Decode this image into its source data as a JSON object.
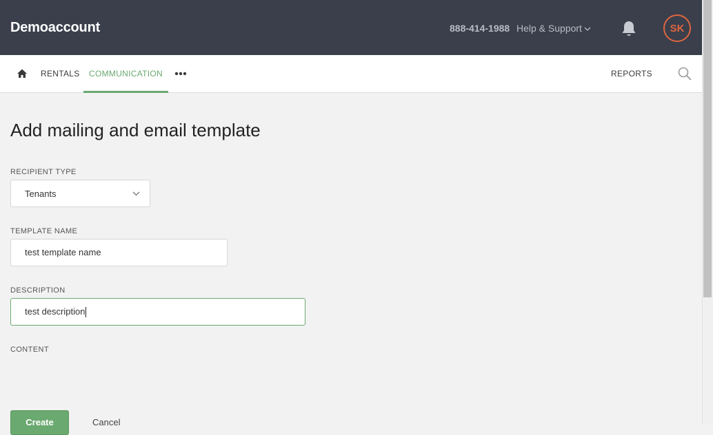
{
  "header": {
    "brand": "Demoaccount",
    "phone": "888-414-1988",
    "help_label": "Help & Support",
    "avatar_initials": "SK"
  },
  "nav": {
    "items": [
      {
        "label": "RENTALS"
      },
      {
        "label": "COMMUNICATION",
        "active": true
      },
      {
        "label": "REPORTS"
      }
    ]
  },
  "page": {
    "title": "Add mailing and email template"
  },
  "form": {
    "recipient_type": {
      "label": "RECIPIENT TYPE",
      "value": "Tenants"
    },
    "template_name": {
      "label": "TEMPLATE NAME",
      "value": "test template name"
    },
    "description": {
      "label": "DESCRIPTION",
      "value": "test description"
    },
    "content": {
      "label": "CONTENT"
    },
    "create_label": "Create",
    "cancel_label": "Cancel"
  },
  "colors": {
    "header_bg": "#3a3f4b",
    "accent_green": "#6aa96f",
    "avatar_orange": "#e0653f"
  },
  "icons": [
    "home-icon",
    "more-dots-icon",
    "search-icon",
    "bell-icon",
    "chevron-down-icon"
  ]
}
